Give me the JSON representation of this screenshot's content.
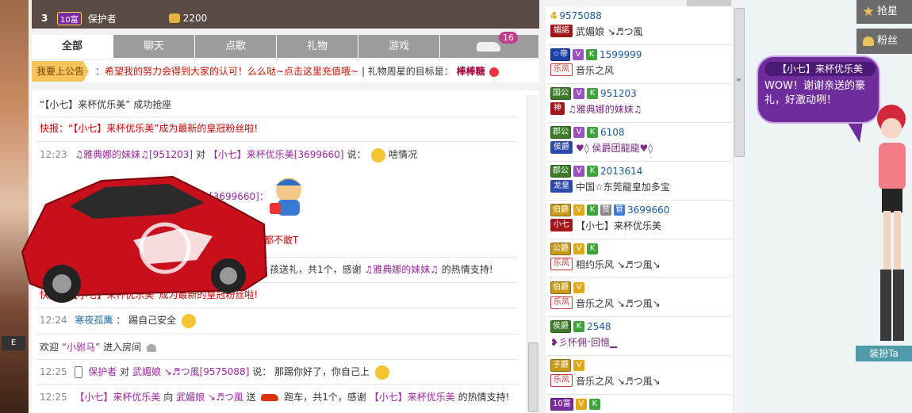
{
  "rank": {
    "number": "3",
    "level_badge": "10富",
    "name": "保护者",
    "coins": "2200"
  },
  "tabs": [
    {
      "label": "全部"
    },
    {
      "label": "聊天"
    },
    {
      "label": "点歌"
    },
    {
      "label": "礼物"
    },
    {
      "label": "游戏"
    }
  ],
  "car_tab_badge": "16",
  "notice": {
    "button": "我要上公告",
    "text": "：希望我的努力会得到大家的认可！么么哒~点击这里充值哦~",
    "goal_label": "| 礼物周星的目标是：",
    "goal_value": "棒棒糖"
  },
  "messages": {
    "m1": "“【小七】来杯优乐美” 成功抢座",
    "m2": "快报：“【小七】来杯优乐美”成为最新的皇冠粉丝啦!",
    "m3": {
      "time": "12:23",
      "user": "♫雅典娜的妹妹♫[951203]",
      "mid": "对",
      "target": "【小七】来杯优乐美[3699660]",
      "said": "说：",
      "text": "啥情况"
    },
    "m4": "[3699660]：",
    "m5": "都不敢T",
    "m6": {
      "pre": "孩送礼，共1个，感谢",
      "user": "♫雅典娜的妹妹♫",
      "post": "的热情支持!"
    },
    "m7": "快报：“【小七】来杯优乐美”成为最新的皇冠粉丝啦!",
    "m8": {
      "time": "12:24",
      "user": "寒夜孤鹰",
      "said": "：",
      "text": "踢自己安全"
    },
    "m9": {
      "pre": "欢迎",
      "user": "“小驸马”",
      "post": "进入房间"
    },
    "m10": {
      "time": "12:25",
      "user": "保护者",
      "mid": "对",
      "target": "武媚娘 ↘♬つ風[9575088]",
      "said": "说：",
      "text": "那踢你好了，你自己上"
    },
    "m11": {
      "time": "12:25",
      "user": "【小七】来杯优乐美",
      "mid": "向",
      "target": "武媚娘 ↘♬つ風",
      "send": "送",
      "gift": "跑车，共1个，感谢",
      "thank_user": "【小七】来杯优乐美",
      "post": "的热情支持!"
    }
  },
  "users": [
    {
      "badges": [
        "4"
      ],
      "id": "9575088",
      "tag": "媚諾",
      "name": "武媚娘 ↘♬つ風"
    },
    {
      "badges": [
        "☆帝",
        "V",
        "K"
      ],
      "id": "1599999",
      "tag": "乐风",
      "name": "音乐之风"
    },
    {
      "badges": [
        "国公",
        "V",
        "K"
      ],
      "id": "951203",
      "tag": "神",
      "name": "♫雅典娜的妹妹♫"
    },
    {
      "badges": [
        "郡公",
        "V",
        "K"
      ],
      "id": "6108",
      "tag": "侯爵",
      "name": "♥◊ 侯爵团龍龍♥◊"
    },
    {
      "badges": [
        "郡公",
        "V",
        "K"
      ],
      "id": "2013614",
      "tag": "龙皇",
      "name": "中国☆东莞龍皇加多宝"
    },
    {
      "badges": [
        "伯爵",
        "V",
        "K",
        "赞",
        "管"
      ],
      "id": "3699660",
      "tag": "小七",
      "name": "【小七】来杯优乐美"
    },
    {
      "badges": [
        "公爵",
        "V",
        "K"
      ],
      "id": "",
      "tag": "乐风",
      "name": "相约乐风 ↘♬つ風↘"
    },
    {
      "badges": [
        "伯爵",
        "V"
      ],
      "id": "",
      "tag": "乐风",
      "name": "音乐之风 ↘♬つ風↘"
    },
    {
      "badges": [
        "侯爵",
        "K"
      ],
      "id": "2548",
      "tag": "",
      "name": "❥彡怀佣ᵕ回憶▁"
    },
    {
      "badges": [
        "子爵",
        "V"
      ],
      "id": "",
      "tag": "乐风",
      "name": "音乐之风 ↘♬つ風↘"
    },
    {
      "badges": [
        "10富",
        "V",
        "K"
      ],
      "id": "",
      "tag": "",
      "name": ""
    }
  ],
  "right": {
    "btn1": "抢星",
    "btn2": "粉丝",
    "bubble_name": "【小七】来杯优乐美",
    "bubble_text": "WOW！谢谢亲送的豪礼，好激动咧！",
    "dress_btn": "装扮Ta"
  },
  "left_mark": "E",
  "colors": {
    "tab_inactive": "#9c9c9c",
    "accent_purple": "#6f2d9c",
    "alert_red": "#cc0000",
    "notice_yellow": "#f3c55a"
  }
}
